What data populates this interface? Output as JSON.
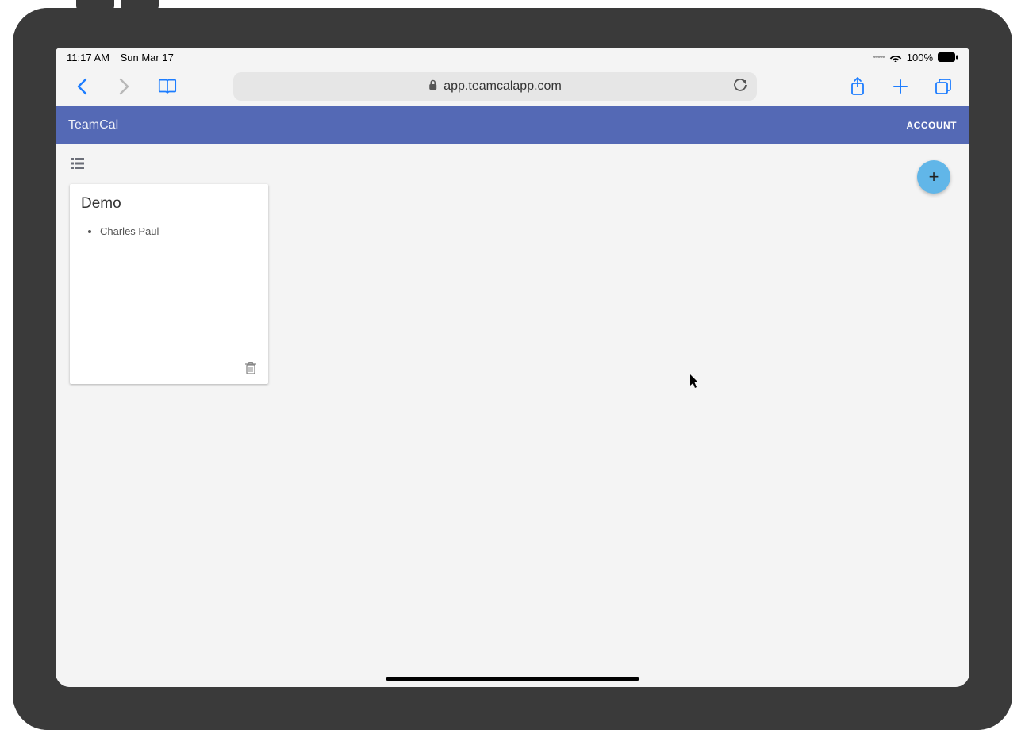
{
  "status": {
    "time": "11:17 AM",
    "date": "Sun Mar 17",
    "battery_pct": "100%"
  },
  "browser": {
    "url_host": "app.teamcalapp.com"
  },
  "app": {
    "title": "TeamCal",
    "account_label": "ACCOUNT"
  },
  "toolbar": {
    "add_fab_label": "+"
  },
  "cards": [
    {
      "title": "Demo",
      "members": [
        "Charles Paul"
      ]
    }
  ]
}
